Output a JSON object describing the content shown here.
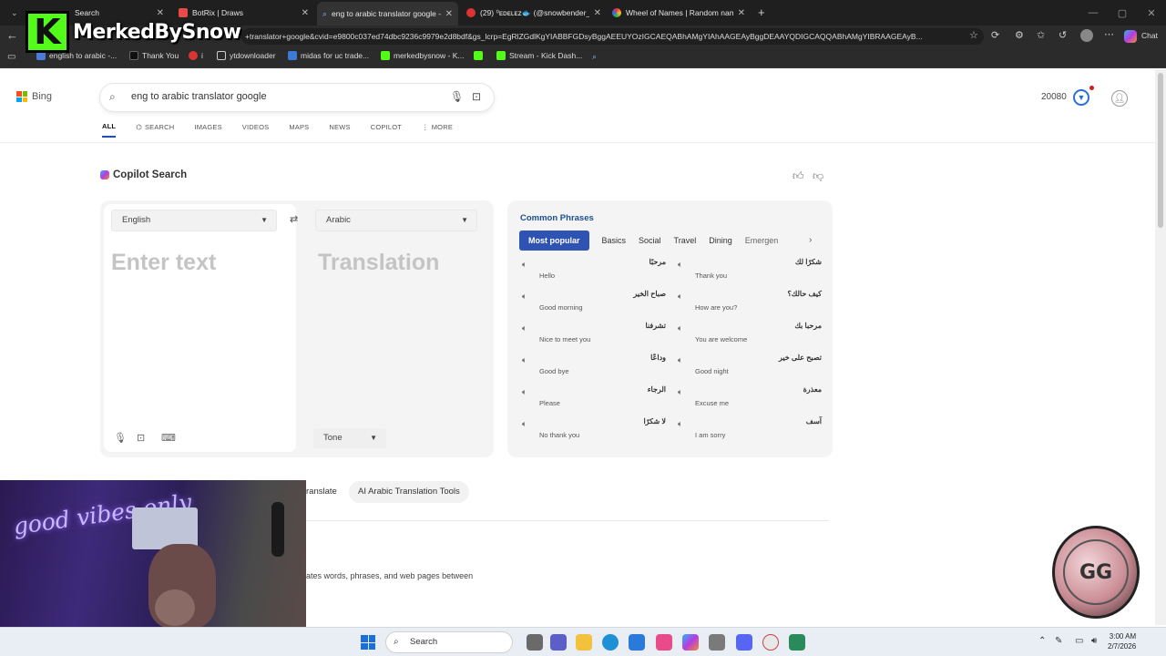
{
  "browser": {
    "tabs": [
      {
        "title": "Search",
        "color": "#555"
      },
      {
        "title": "BotRix | Draws",
        "color": "#e84a4a"
      },
      {
        "title": "eng to arabic translator google - S",
        "color": "#4a7bd6"
      },
      {
        "title": "(29) ⁰ᴇᴅᴇʟᴇᴢ🐟 (@snowbender_",
        "color": "#e33"
      },
      {
        "title": "Wheel of Names | Random name p",
        "color": "#f0a020"
      }
    ],
    "url": "+translator+google&cvid=e9800c037ed74dbc9236c9979e2d8bdf&gs_lcrp=EgRlZGdlKgYIABBFGDsyBggAEEUYOzIGCAEQABhAMgYIAhAAGEAyBggDEAAYQDIGCAQQABhAMgYIBRAAGEAyB...",
    "chat_label": "Chat",
    "bookmarks": [
      "english to arabic -...",
      "Thank You",
      "i",
      "ytdownloader",
      "midas for uc trade...",
      "merkedbysnow - K...",
      "Stream - Kick Dash..."
    ]
  },
  "overlay_logo": {
    "letter": "K",
    "text": "MerkedBySnow"
  },
  "bing": {
    "brand": "Bing",
    "query": "eng to arabic translator google",
    "points": "20080",
    "nav": [
      {
        "label": "ALL",
        "active": true
      },
      {
        "label": "SEARCH"
      },
      {
        "label": "IMAGES"
      },
      {
        "label": "VIDEOS"
      },
      {
        "label": "MAPS"
      },
      {
        "label": "NEWS"
      },
      {
        "label": "COPILOT"
      },
      {
        "label": "MORE"
      }
    ],
    "copilot_title": "Copilot Search"
  },
  "translator": {
    "source_lang": "English",
    "target_lang": "Arabic",
    "input_placeholder": "Enter text",
    "output_placeholder": "Translation",
    "tone_label": "Tone"
  },
  "phrases": {
    "title": "Common Phrases",
    "tabs": [
      "Most popular",
      "Basics",
      "Social",
      "Travel",
      "Dining",
      "Emergen"
    ],
    "items": [
      {
        "ar": "مرحبًا",
        "en": "Hello"
      },
      {
        "ar": "شكرًا لك",
        "en": "Thank you"
      },
      {
        "ar": "صباح الخير",
        "en": "Good morning"
      },
      {
        "ar": "كيف حالك؟",
        "en": "How are you?"
      },
      {
        "ar": "تشرفنا",
        "en": "Nice to meet you"
      },
      {
        "ar": "مرحبا بك",
        "en": "You are welcome"
      },
      {
        "ar": "وداعًا",
        "en": "Good bye"
      },
      {
        "ar": "تصبح على خير",
        "en": "Good night"
      },
      {
        "ar": "الرجاء",
        "en": "Please"
      },
      {
        "ar": "معذرة",
        "en": "Excuse me"
      },
      {
        "ar": "لا شكرًا",
        "en": "No thank you"
      },
      {
        "ar": "آسف",
        "en": "I am sorry"
      }
    ]
  },
  "chips": [
    "ranslate",
    "AI Arabic Translation Tools"
  ],
  "snippet": "ates words, phrases, and web pages between",
  "webcam": {
    "neon_text": "good vibes only"
  },
  "badge": {
    "text": "GG"
  },
  "taskbar": {
    "search_label": "Search",
    "time": "3:00 AM",
    "date": "2/7/2026"
  }
}
